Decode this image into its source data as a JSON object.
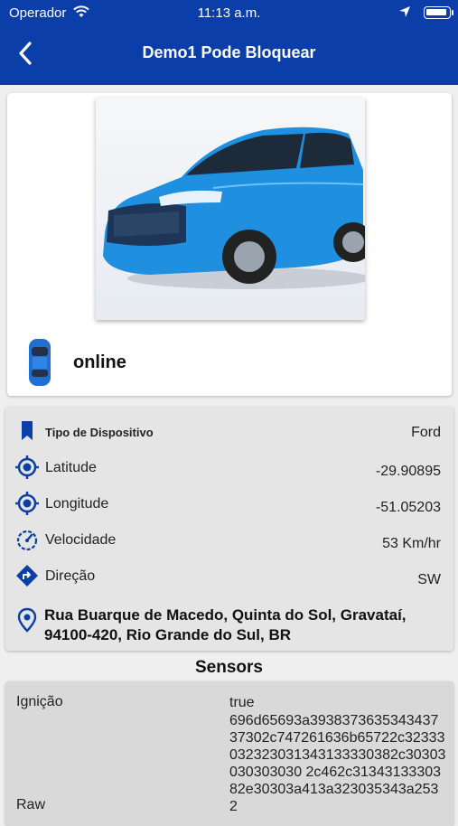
{
  "status": {
    "carrier": "Operador",
    "time": "11:13 a.m."
  },
  "header": {
    "title": "Demo1 Pode Bloquear",
    "back_icon": "chevron-left-icon"
  },
  "vehicle": {
    "state": "online"
  },
  "details": {
    "device_type_label": "Tipo de Dispositivo",
    "device_type_value": "Ford",
    "latitude_label": "Latitude",
    "latitude_value": "-29.90895",
    "longitude_label": "Longitude",
    "longitude_value": "-51.05203",
    "speed_label": "Velocidade",
    "speed_value": "53 Km/hr",
    "direction_label": "Direção",
    "direction_value": "SW",
    "address": "Rua Buarque de Macedo, Quinta do Sol, Gravataí, 94100-420, Rio Grande do Sul, BR"
  },
  "sensors": {
    "title": "Sensors",
    "ignition_label": "Ignição",
    "ignition_value": "true",
    "raw_label": "Raw",
    "raw_value": "696d65693a393837363534343737302c747261636b65722c32333032323031343133330382c30303030303030 2c462c3134313330382e30303a413a323035343a2532"
  },
  "colors": {
    "header": "#0b3ea8",
    "car": "#1f8fe0",
    "icon": "#0b3ea8"
  }
}
